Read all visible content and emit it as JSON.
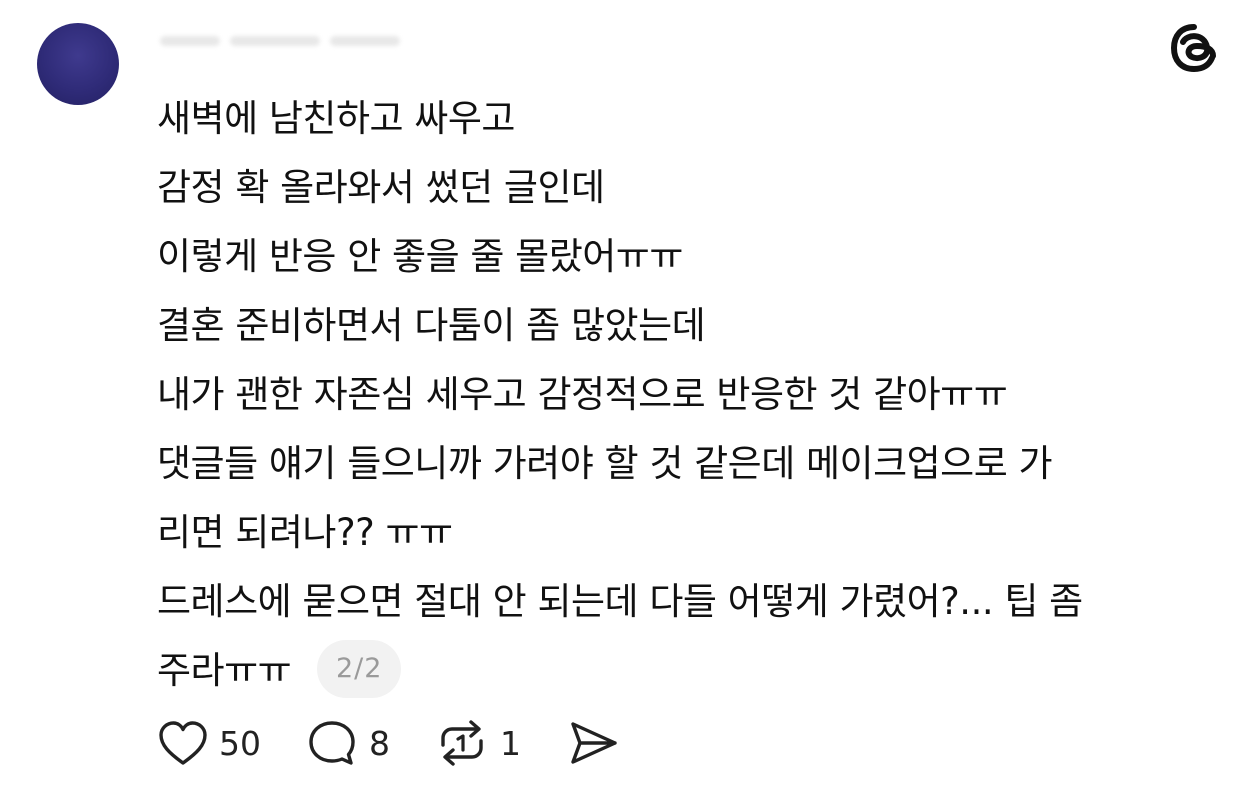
{
  "post": {
    "lines": [
      "새벽에 남친하고 싸우고",
      "감정 확 올라와서 썼던 글인데",
      "이렇게 반응 안 좋을 줄 몰랐어ㅠㅠ",
      "결혼 준비하면서 다툼이 좀 많았는데",
      "내가 괜한 자존심 세우고 감정적으로 반응한 것 같아ㅠㅠ",
      "댓글들 얘기 들으니까 가려야 할 것 같은데 메이크업으로 가",
      "리면 되려나?? ㅠㅠ",
      "드레스에 묻으면 절대 안 되는데 다들 어떻게 가렸어?... 팁 좀",
      "주라ㅠㅠ"
    ],
    "page_indicator": "2/2"
  },
  "actions": {
    "likes": "50",
    "comments": "8",
    "reposts": "1"
  },
  "icons": {
    "app_logo": "threads-logo-icon",
    "like": "heart-icon",
    "comment": "comment-bubble-icon",
    "repost": "repost-icon",
    "share": "send-icon"
  },
  "colors": {
    "avatar": "#2f2b78",
    "text": "#111111",
    "badge_bg": "#f2f2f2",
    "badge_text": "#9a9a9a"
  }
}
